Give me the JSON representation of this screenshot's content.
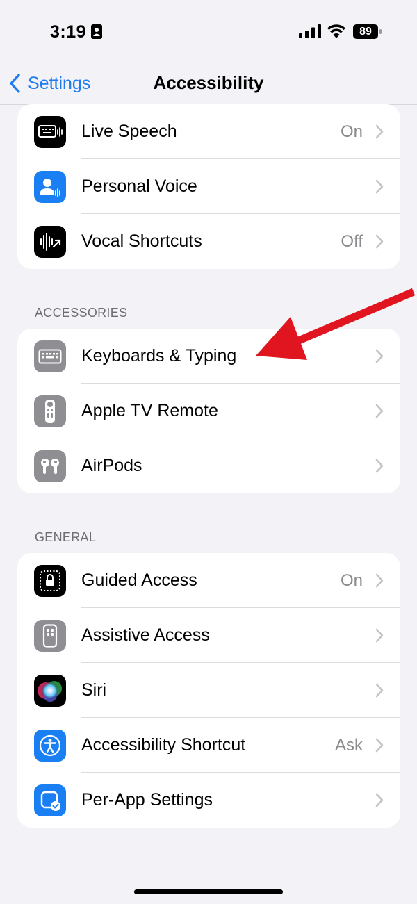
{
  "status_bar": {
    "time": "3:19",
    "battery": "89"
  },
  "nav": {
    "back_label": "Settings",
    "title": "Accessibility"
  },
  "groups": [
    {
      "header": "",
      "rows": [
        {
          "label": "Live Speech",
          "value": "On",
          "icon": "keyboard-waveform-icon",
          "icon_bg": "#000000"
        },
        {
          "label": "Personal Voice",
          "value": "",
          "icon": "person-waveform-icon",
          "icon_bg": "#1a7ff2"
        },
        {
          "label": "Vocal Shortcuts",
          "value": "Off",
          "icon": "waveform-icon",
          "icon_bg": "#000000"
        }
      ]
    },
    {
      "header": "ACCESSORIES",
      "rows": [
        {
          "label": "Keyboards & Typing",
          "value": "",
          "icon": "keyboard-icon",
          "icon_bg": "#8e8e93"
        },
        {
          "label": "Apple TV Remote",
          "value": "",
          "icon": "remote-icon",
          "icon_bg": "#8e8e93"
        },
        {
          "label": "AirPods",
          "value": "",
          "icon": "airpods-icon",
          "icon_bg": "#8e8e93"
        }
      ]
    },
    {
      "header": "GENERAL",
      "rows": [
        {
          "label": "Guided Access",
          "value": "On",
          "icon": "lock-dotted-icon",
          "icon_bg": "#000000"
        },
        {
          "label": "Assistive Access",
          "value": "",
          "icon": "phone-grid-icon",
          "icon_bg": "#8e8e93"
        },
        {
          "label": "Siri",
          "value": "",
          "icon": "siri-icon",
          "icon_bg": "#000000"
        },
        {
          "label": "Accessibility Shortcut",
          "value": "Ask",
          "icon": "accessibility-icon",
          "icon_bg": "#1a7ff2"
        },
        {
          "label": "Per-App Settings",
          "value": "",
          "icon": "app-check-icon",
          "icon_bg": "#1a7ff2"
        }
      ]
    }
  ],
  "colors": {
    "accent": "#1e7cf0",
    "background": "#f2f2f7",
    "annotation_arrow": "#e0151f"
  }
}
